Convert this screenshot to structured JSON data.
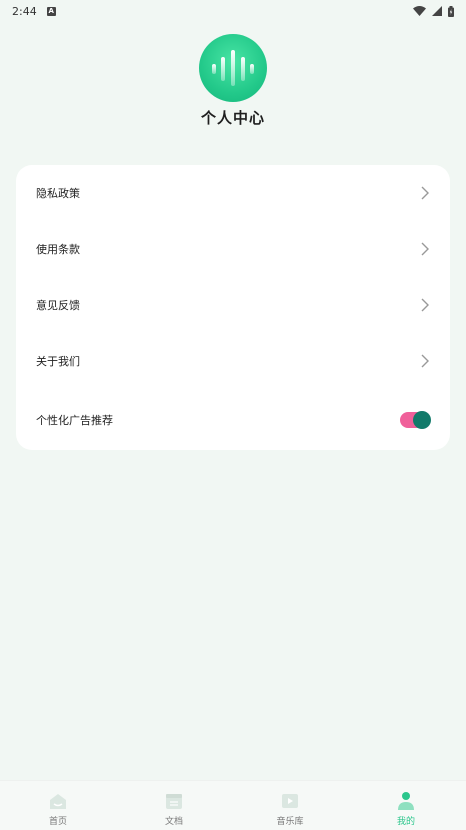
{
  "status_bar": {
    "time": "2:44",
    "notification_glyph": "A"
  },
  "header": {
    "title": "个人中心",
    "avatar_icon": "sound-wave-icon",
    "avatar_color": "#23c98a"
  },
  "menu": {
    "items": [
      {
        "label": "隐私政策",
        "icon": "chevron-right-icon"
      },
      {
        "label": "使用条款",
        "icon": "chevron-right-icon"
      },
      {
        "label": "意见反馈",
        "icon": "chevron-right-icon"
      },
      {
        "label": "关于我们",
        "icon": "chevron-right-icon"
      }
    ],
    "toggle_item": {
      "label": "个性化广告推荐",
      "enabled": true,
      "track_color": "#f0609a",
      "knob_color": "#127a6a"
    }
  },
  "bottom_nav": {
    "items": [
      {
        "label": "首页",
        "icon": "home-icon",
        "active": false
      },
      {
        "label": "文档",
        "icon": "document-icon",
        "active": false
      },
      {
        "label": "音乐库",
        "icon": "music-library-icon",
        "active": false
      },
      {
        "label": "我的",
        "icon": "user-icon",
        "active": true
      }
    ],
    "active_color": "#2bc68c"
  }
}
